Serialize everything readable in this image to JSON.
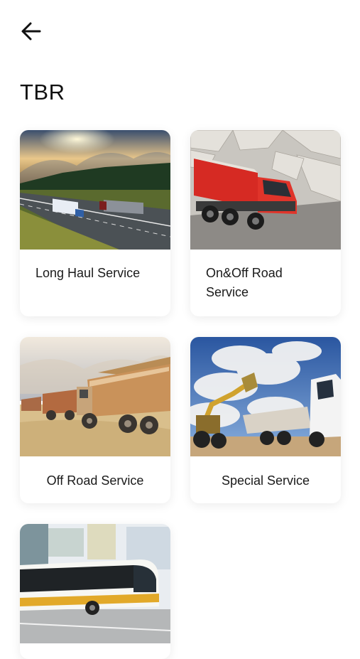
{
  "header": {
    "back_icon": "arrow-left-icon",
    "title": "TBR"
  },
  "services": [
    {
      "label": "Long Haul Service",
      "image": "highway-trucks-sunset"
    },
    {
      "label": "On&Off Road Service",
      "image": "red-dump-truck-rocks"
    },
    {
      "label": "Off Road Service",
      "image": "dump-trucks-sand"
    },
    {
      "label": "Special Service",
      "image": "excavator-and-truck"
    },
    {
      "label": "",
      "image": "city-bus"
    }
  ],
  "colors": {
    "background": "#ffffff",
    "text": "#111111"
  }
}
